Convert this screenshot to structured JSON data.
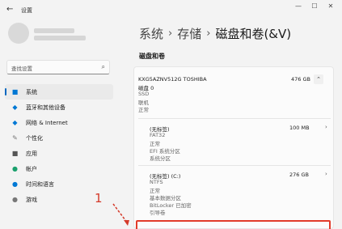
{
  "window": {
    "title": "设置",
    "back_icon": "back-arrow-icon"
  },
  "sidebar": {
    "search_placeholder": "查找设置",
    "items": [
      {
        "label": "系统",
        "icon": "■",
        "color": "#0078d4"
      },
      {
        "label": "蓝牙和其他设备",
        "icon": "◆",
        "color": "#0078d4"
      },
      {
        "label": "网络 & Internet",
        "icon": "◆",
        "color": "#0078d4"
      },
      {
        "label": "个性化",
        "icon": "✎",
        "color": "#777777"
      },
      {
        "label": "应用",
        "icon": "■",
        "color": "#555555"
      },
      {
        "label": "帐户",
        "icon": "●",
        "color": "#1aa06d"
      },
      {
        "label": "时间和语言",
        "icon": "●",
        "color": "#0078d4"
      },
      {
        "label": "游戏",
        "icon": "●",
        "color": "#777777"
      }
    ]
  },
  "main": {
    "breadcrumb": [
      "系统",
      "存储",
      "磁盘和卷(&V)"
    ],
    "section_title": "磁盘和卷",
    "disk": {
      "name": "KXG5AZNV512G TOSHIBA",
      "size": "476 GB",
      "details": [
        "磁盘 0",
        "SSD",
        "联机",
        "正常"
      ]
    },
    "partitions": [
      {
        "label": "(无标签)",
        "size": "100 MB",
        "details": [
          "FAT32",
          "正常",
          "EFI 系统分区",
          "系统分区"
        ]
      },
      {
        "label": "(无标签) (C:)",
        "size": "276 GB",
        "details": [
          "NTFS",
          "正常",
          "基本数据分区",
          "BitLocker 已加密",
          "引导卷"
        ]
      }
    ]
  },
  "annotation": {
    "number": "1",
    "color": "#d43a2a"
  }
}
